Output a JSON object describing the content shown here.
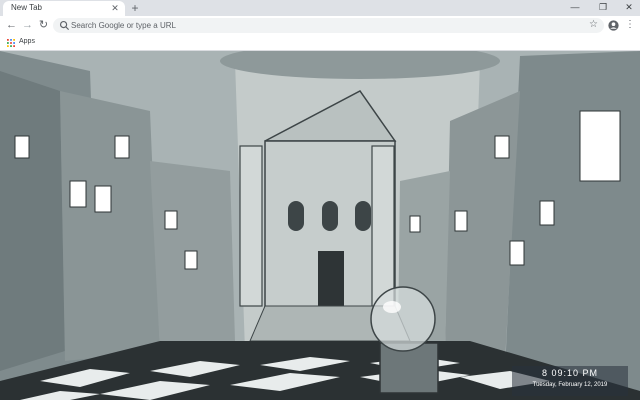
{
  "tabs": [
    {
      "title": "New Tab"
    }
  ],
  "toolbar": {
    "omnibox_placeholder": "Search Google or type a URL"
  },
  "bookmarks": [
    {
      "label": "Apps"
    }
  ],
  "clock": {
    "time": "8 09:10 PM",
    "date": "Tuesday, February 12, 2019"
  }
}
